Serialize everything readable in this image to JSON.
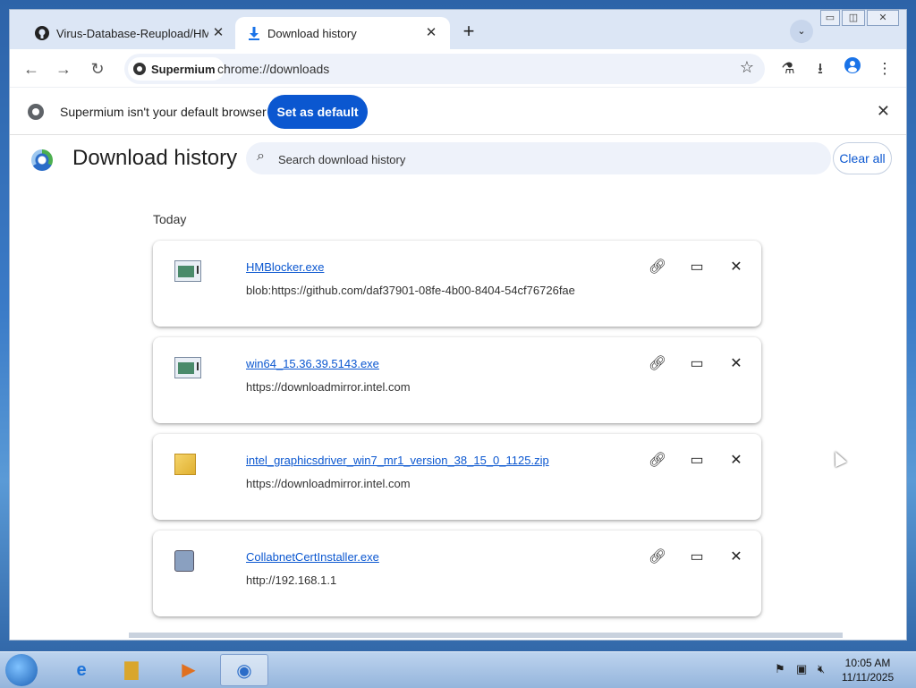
{
  "tabs": [
    {
      "title": "Virus-Database-Reupload/HMBlocker",
      "icon": "github-icon",
      "active": false
    },
    {
      "title": "Download history",
      "icon": "download-icon",
      "active": true
    }
  ],
  "toolbar": {
    "site_chip": "Supermium",
    "url": "chrome://downloads"
  },
  "infobar": {
    "message": "Supermium isn't your default browser",
    "button": "Set as default"
  },
  "page": {
    "title": "Download history",
    "search_placeholder": "Search download history",
    "clear_all": "Clear all",
    "section": "Today"
  },
  "downloads": [
    {
      "name": "HMBlocker.exe",
      "url": "blob:https://github.com/daf37901-08fe-4b00-8404-54cf76726fae",
      "icon": "exe-icon"
    },
    {
      "name": "win64_15.36.39.5143.exe",
      "url": "https://downloadmirror.intel.com",
      "icon": "exe-icon"
    },
    {
      "name": "intel_graphicsdriver_win7_mr1_version_38_15_0_1125.zip",
      "url": "https://downloadmirror.intel.com",
      "icon": "zip-icon"
    },
    {
      "name": "CollabnetCertInstaller.exe",
      "url": "http://192.168.1.1",
      "icon": "installer-icon"
    }
  ],
  "taskbar": {
    "time": "10:05 AM",
    "date": "11/11/2025"
  },
  "colors": {
    "accent": "#0b57d0",
    "tabstrip": "#dce6f5"
  }
}
